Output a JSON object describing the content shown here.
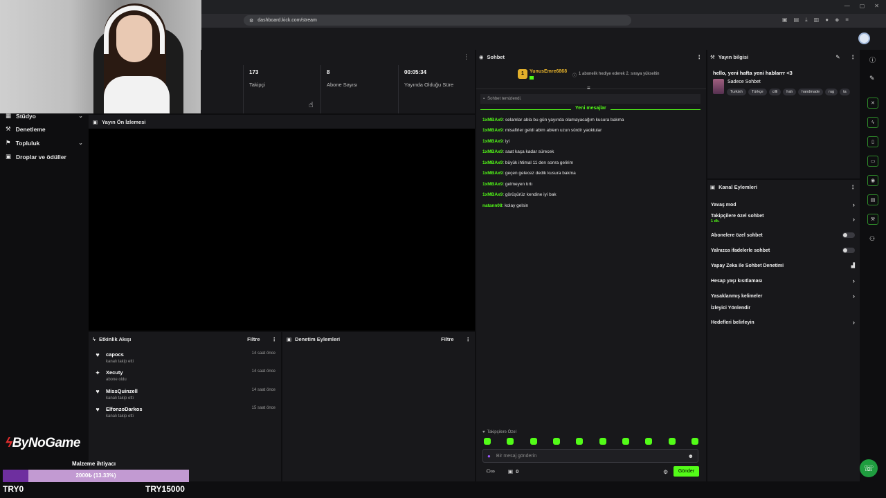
{
  "browser": {
    "url": "dashboard.kick.com/stream",
    "window_controls": [
      "—",
      "▢",
      "✕"
    ]
  },
  "stats": [
    {
      "value": "173",
      "label": "Takipçi"
    },
    {
      "value": "8",
      "label": "Abone Sayısı"
    },
    {
      "value": "00:05:34",
      "label": "Yayında Olduğu Süre"
    }
  ],
  "sidebar": {
    "items": [
      {
        "label": "Stüdyo",
        "icon": "studio-icon",
        "has_chevron": true
      },
      {
        "label": "Denetleme",
        "icon": "shield-icon",
        "has_chevron": false
      },
      {
        "label": "Topluluk",
        "icon": "community-icon",
        "has_chevron": true
      },
      {
        "label": "Droplar ve ödüller",
        "icon": "gift-icon",
        "has_chevron": false
      }
    ]
  },
  "preview": {
    "title": "Yayın Ön İzlemesi"
  },
  "activity": {
    "title": "Etkinlik Akışı",
    "filter_label": "Filtre",
    "items": [
      {
        "name": "capocs",
        "action": "kanalı takip etti",
        "time": "14 saat önce",
        "icon": "heart-icon"
      },
      {
        "name": "Xecuty",
        "action": "abone oldu",
        "time": "14 saat önce",
        "icon": "star-icon"
      },
      {
        "name": "MissQuinzell",
        "action": "kanalı takip etti",
        "time": "14 saat önce",
        "icon": "heart-icon"
      },
      {
        "name": "ElfonzoDarkos",
        "action": "kanalı takip etti",
        "time": "15 saat önce",
        "icon": "heart-icon"
      }
    ]
  },
  "moderation": {
    "title": "Denetim Eylemleri",
    "filter_label": "Filtre"
  },
  "chat": {
    "title": "Sohbet",
    "pinned_user": "YunusEmre6868",
    "pinned_message": "1 abonelik hediye ederek 2. sıraya yükseltin",
    "pinned_rank": "1",
    "cleared_notice": "Sohbet temizlendi.",
    "new_messages_label": "Yeni mesajlar",
    "messages": [
      {
        "user": "1xMBAx9",
        "text": "selamlar abla bu gün yayında olamayacağım kusura bakma"
      },
      {
        "user": "1xMBAx9",
        "text": "misafirler geldi abim ablem uzun sürdir yaoktular"
      },
      {
        "user": "1xMBAx9",
        "text": "iyi"
      },
      {
        "user": "1xMBAx9",
        "text": "saat kaça kadar sürecek"
      },
      {
        "user": "1xMBAx9",
        "text": "büyük ihtimal 11 den sonra gelirim"
      },
      {
        "user": "1xMBAx9",
        "text": "geçen gelecez dedik kusura bakma"
      },
      {
        "user": "1xMBAx9",
        "text": "gelmeyen tırtı"
      },
      {
        "user": "1xMBAx9",
        "text": "görüşürüz kendine iyi bak"
      },
      {
        "user": "natann08",
        "text": "kolay gelsin"
      }
    ],
    "followers_only_label": "Takipçilere Özel",
    "input_placeholder": "Bir mesaj gönderin",
    "counter": "0",
    "send_label": "Gönder",
    "emote_count": 10
  },
  "stream_info": {
    "title": "Yayın bilgisi",
    "stream_title": "hello, yeni hafta yeni hablarrr <3",
    "category": "Sadece Sohbet",
    "tags": [
      "Turkish",
      "Türkçe",
      "cilli",
      "halı",
      "handmade",
      "rug",
      "ta"
    ]
  },
  "channel_actions": {
    "title": "Kanal Eylemleri",
    "items": [
      {
        "label": "Yavaş mod",
        "control": "chevron"
      },
      {
        "label": "Takipçilere özel sohbet",
        "sub": "1 dk.",
        "control": "chevron"
      },
      {
        "label": "Abonelere özel sohbet",
        "control": "toggle",
        "enabled": false
      },
      {
        "label": "Yalnızca ifadelerle sohbet",
        "control": "toggle",
        "enabled": false
      },
      {
        "label": "Yapay Zeka ile Sohbet Denetimi",
        "control": "chart"
      },
      {
        "label": "Hesap yaşı kısıtlaması",
        "control": "chevron"
      },
      {
        "label": "Yasaklanmış kelimeler",
        "control": "chevron"
      },
      {
        "label": "İzleyici Yönlendir",
        "control": "none"
      },
      {
        "label": "Hedefleri belirleyin",
        "control": "chevron"
      }
    ]
  },
  "overlay": {
    "brand": "ByNoGame",
    "goal_label": "Malzeme ihtiyacı",
    "goal_progress_text": "2000₺ (13.33%)",
    "goal_progress": 0.1333,
    "goal_min": "TRY0",
    "goal_max": "TRY15000"
  },
  "colors": {
    "accent": "#53fc18",
    "panel": "#18181b",
    "background": "#0e0e10",
    "goal_fill": "#6e2f9f",
    "goal_track": "#c29ad2"
  }
}
